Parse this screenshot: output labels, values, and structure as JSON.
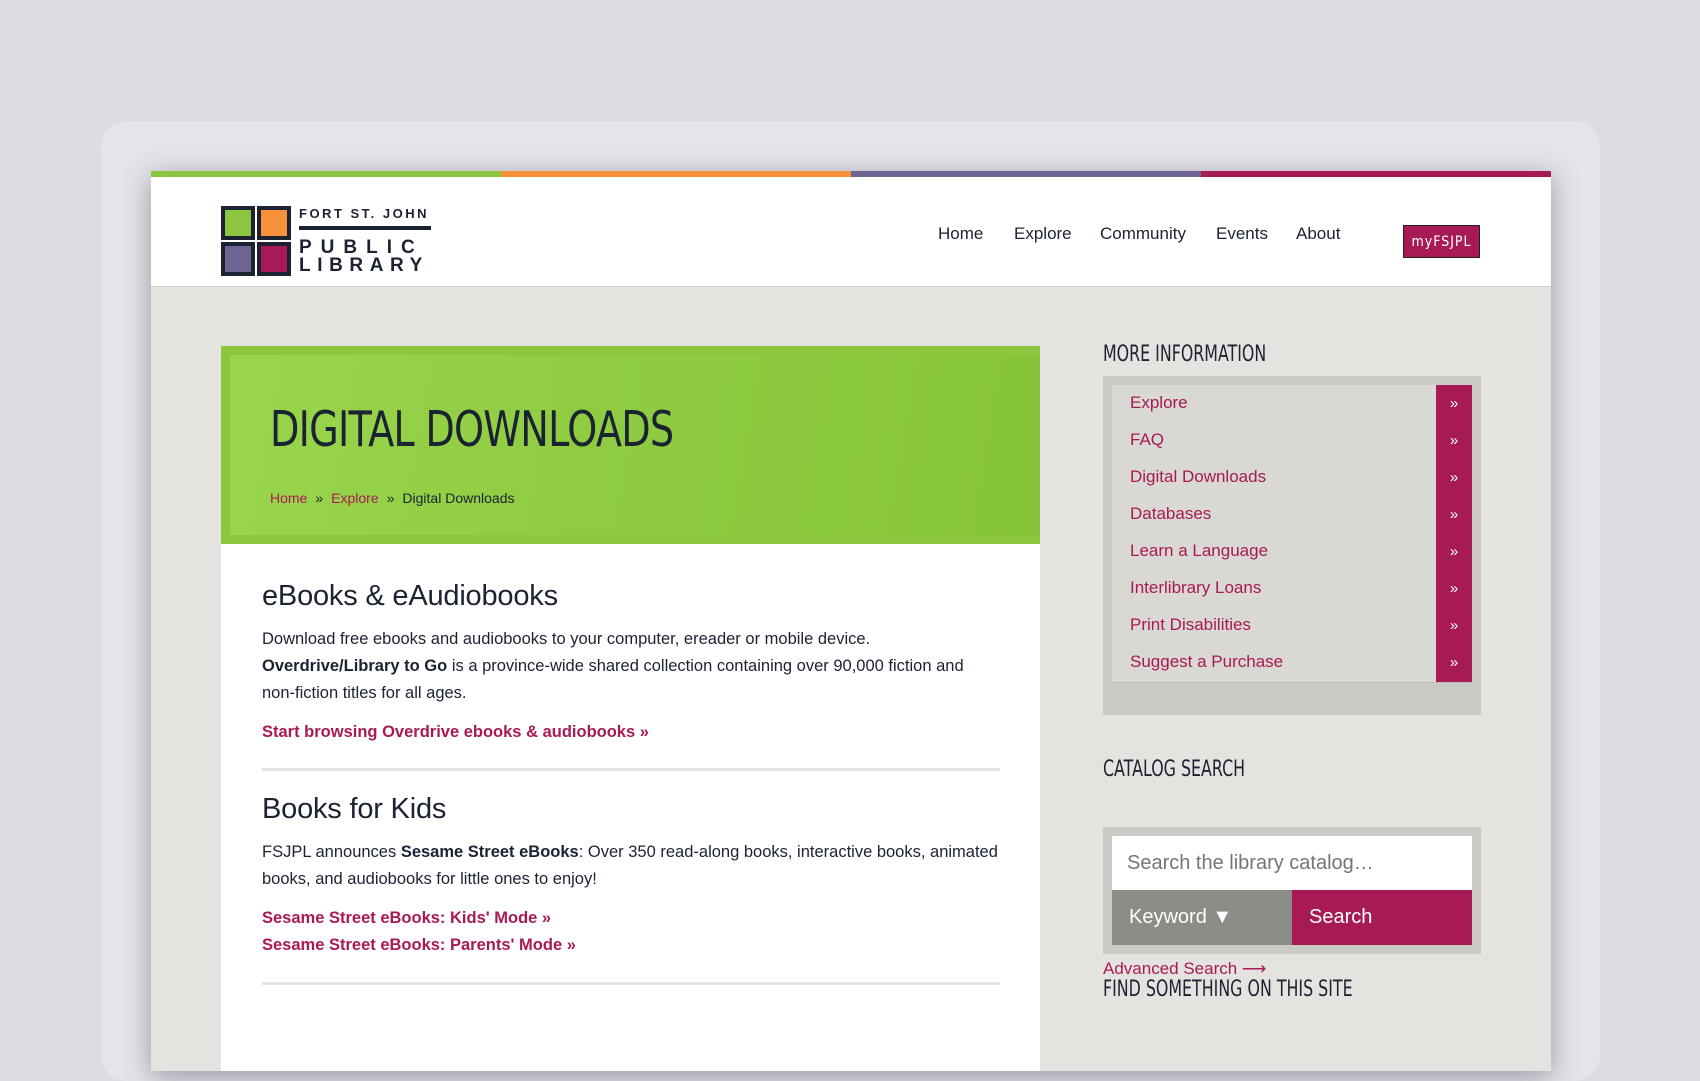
{
  "brand_colors": {
    "green": "#8cc63f",
    "orange": "#f7923a",
    "purple": "#6f6391",
    "magenta": "#a81a55",
    "navy": "#1b2232"
  },
  "logo": {
    "line1": "FORT ST. JOHN",
    "line2": "PUBLIC",
    "line3": "LIBRARY"
  },
  "nav": {
    "items": [
      "Home",
      "Explore",
      "Community",
      "Events",
      "About"
    ],
    "account": "myFSJPL"
  },
  "hero": {
    "title": "DIGITAL DOWNLOADS",
    "breadcrumb": {
      "home": "Home",
      "explore": "Explore",
      "current": "Digital Downloads",
      "separator": "»"
    }
  },
  "sections": [
    {
      "heading": "eBooks & eAudiobooks",
      "text_before": "Download free ebooks and audiobooks to your computer, ereader or mobile device. ",
      "text_bold": "Overdrive/Library to Go",
      "text_after": " is a province-wide shared collection containing over 90,000 fiction and non-fiction titles for all ages.",
      "links": [
        "Start browsing Overdrive ebooks & audiobooks »"
      ]
    },
    {
      "heading": "Books for Kids",
      "text_before": "FSJPL announces ",
      "text_bold": "Sesame Street eBooks",
      "text_after": ": Over 350 read-along books, interactive books, animated books, and audiobooks for little ones to enjoy!",
      "links": [
        "Sesame Street eBooks: Kids' Mode »",
        "Sesame Street eBooks: Parents' Mode »"
      ]
    }
  ],
  "sidebar": {
    "more_info_heading": "MORE INFORMATION",
    "more_info_items": [
      "Explore",
      "FAQ",
      "Digital Downloads",
      "Databases",
      "Learn a Language",
      "Interlibrary Loans",
      "Print Disabilities",
      "Suggest a Purchase"
    ],
    "arrow": "»",
    "catalog_heading": "CATALOG SEARCH",
    "catalog_placeholder": "Search the library catalog…",
    "catalog_select": "Keyword ▼",
    "catalog_button": "Search",
    "advanced_link": "Advanced Search ⟶",
    "find_heading": "FIND SOMETHING ON THIS SITE"
  }
}
